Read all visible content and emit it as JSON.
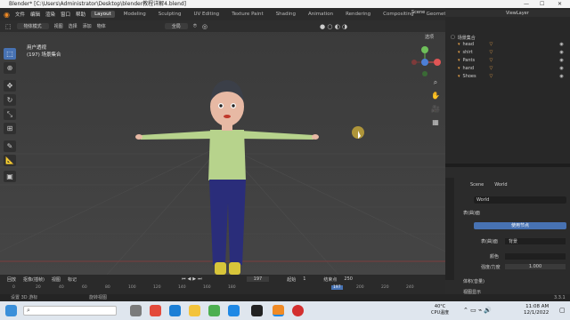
{
  "window": {
    "title": "Blender* [C:\\Users\\Administrator\\Desktop\\blender教程详解4.blend]",
    "min": "—",
    "max": "☐",
    "close": "✕"
  },
  "menus": [
    "文件",
    "编辑",
    "渲染",
    "窗口",
    "帮助"
  ],
  "workspaces": [
    {
      "label": "Layout",
      "active": true
    },
    {
      "label": "Modeling"
    },
    {
      "label": "Sculpting"
    },
    {
      "label": "UV Editing"
    },
    {
      "label": "Texture Paint"
    },
    {
      "label": "Shading"
    },
    {
      "label": "Animation"
    },
    {
      "label": "Rendering"
    },
    {
      "label": "Compositing"
    },
    {
      "label": "Geometry Nodes"
    }
  ],
  "scene_label": "Scene",
  "viewlayer_label": "ViewLayer",
  "viewport": {
    "mode": "物体模式",
    "menu": [
      "视图",
      "选择",
      "添加",
      "物体"
    ],
    "transform": "全局",
    "options": "选项",
    "info_line1": "用户透视",
    "info_line2": "(197) 场景集合"
  },
  "outliner": {
    "root": "场景集合",
    "items": [
      "head",
      "shirt",
      "Pants",
      "hand",
      "Shoes"
    ]
  },
  "properties": {
    "breadcrumb_scene": "Scene",
    "breadcrumb_world": "World",
    "world_name": "World",
    "surface_label": "表(曲)面",
    "use_nodes": "使用节点",
    "surface_field": "表(曲)面",
    "surface_value": "背景",
    "color_label": "颜色",
    "strength_label": "强度/力度",
    "strength_value": "1.000",
    "volume_label": "体积(音量)",
    "viewport_display": "视图显示"
  },
  "timeline": {
    "playback": "回放",
    "keying": "抠像(插帧)",
    "view": "视图",
    "marker": "标记",
    "current_frame": "197",
    "start_label": "起始",
    "start": "1",
    "end_label": "结束点",
    "end": "250",
    "ruler": [
      "0",
      "20",
      "40",
      "60",
      "80",
      "100",
      "120",
      "140",
      "160",
      "180",
      "197",
      "200",
      "220",
      "240"
    ]
  },
  "status": {
    "left": "设置 3D 游标",
    "mid": "旋转视图",
    "version": "3.3.1"
  },
  "taskbar": {
    "temp": "40°C",
    "cpu": "CPU温度",
    "time": "11:08 AM",
    "date": "12/1/2022"
  },
  "colors": {
    "accent": "#4772b3",
    "shirt": "#b7d38c",
    "pants": "#2a2d7a",
    "shoes": "#d8c53a",
    "skin": "#e7b9a4",
    "hair": "#3b3f48"
  }
}
